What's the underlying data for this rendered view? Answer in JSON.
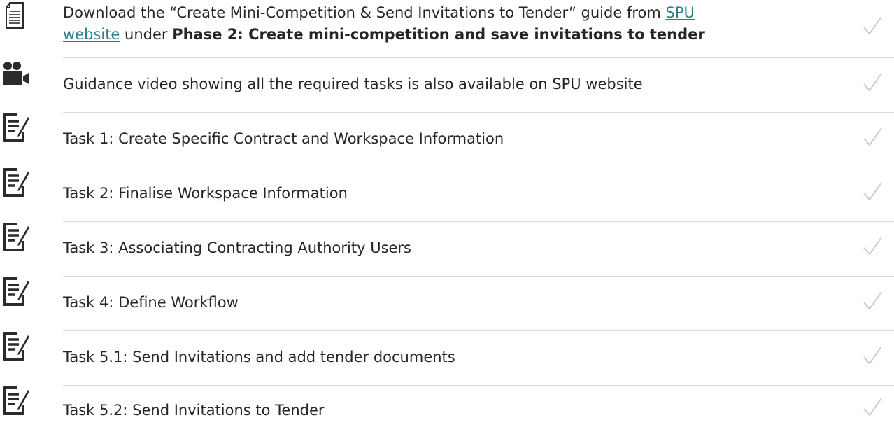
{
  "rows": [
    {
      "icon": "document-icon",
      "text_before": "Download the “Create Mini-Competition & Send Invitations to Tender” guide from ",
      "link": "SPU",
      "link_cont": "website",
      "text_mid": " under ",
      "bold": "Phase 2: Create mini-competition and save invitations to tender",
      "check": "checkmark-icon"
    },
    {
      "icon": "video-camera-icon",
      "text": "Guidance video showing all the required tasks is also available on SPU website",
      "check": "checkmark-icon"
    },
    {
      "icon": "edit-document-icon",
      "text": "Task 1: Create Specific Contract and Workspace Information",
      "check": "checkmark-icon"
    },
    {
      "icon": "edit-document-icon",
      "text": "Task 2: Finalise Workspace Information",
      "check": "checkmark-icon"
    },
    {
      "icon": "edit-document-icon",
      "text": "Task 3: Associating Contracting Authority Users",
      "check": "checkmark-icon"
    },
    {
      "icon": "edit-document-icon",
      "text": "Task 4: Define Workflow",
      "check": "checkmark-icon"
    },
    {
      "icon": "edit-document-icon",
      "text": "Task 5.1: Send Invitations and add tender documents",
      "check": "checkmark-icon"
    },
    {
      "icon": "edit-document-icon",
      "text": "Task 5.2: Send Invitations to Tender",
      "check": "checkmark-icon"
    }
  ],
  "colors": {
    "text": "#262626",
    "link": "#2e7d8a",
    "icon": "#2b2b2b",
    "check": "#c8c8c8",
    "separator": "#d9d9d9"
  }
}
